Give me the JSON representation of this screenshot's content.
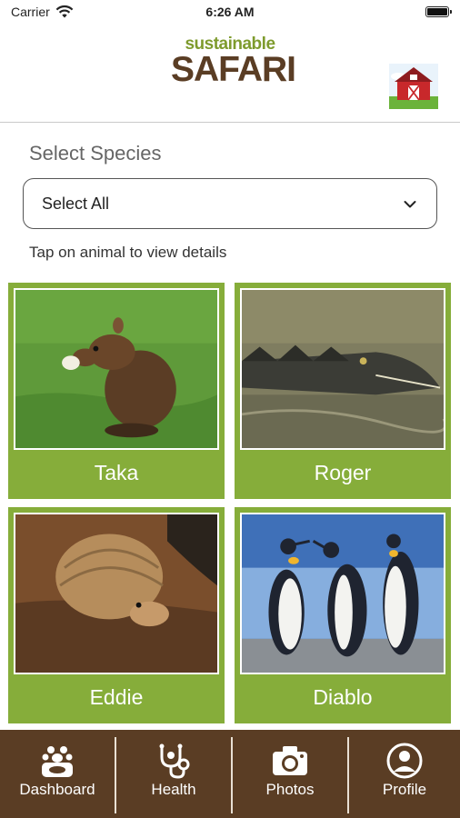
{
  "status_bar": {
    "carrier": "Carrier",
    "time": "6:26 AM"
  },
  "header": {
    "logo_top": "sustainable",
    "logo_bottom": "SAFARI"
  },
  "species_select": {
    "title": "Select Species",
    "selected_value": "Select All"
  },
  "hint": "Tap on animal to view details",
  "animals": [
    {
      "name": "Taka"
    },
    {
      "name": "Roger"
    },
    {
      "name": "Eddie"
    },
    {
      "name": "Diablo"
    }
  ],
  "tabs": [
    {
      "label": "Dashboard",
      "icon": "dashboard-icon"
    },
    {
      "label": "Health",
      "icon": "stethoscope-icon"
    },
    {
      "label": "Photos",
      "icon": "camera-icon"
    },
    {
      "label": "Profile",
      "icon": "profile-icon"
    }
  ],
  "colors": {
    "card_green": "#86ad3a",
    "brown": "#5a3d24",
    "logo_green": "#7e9b2d"
  }
}
